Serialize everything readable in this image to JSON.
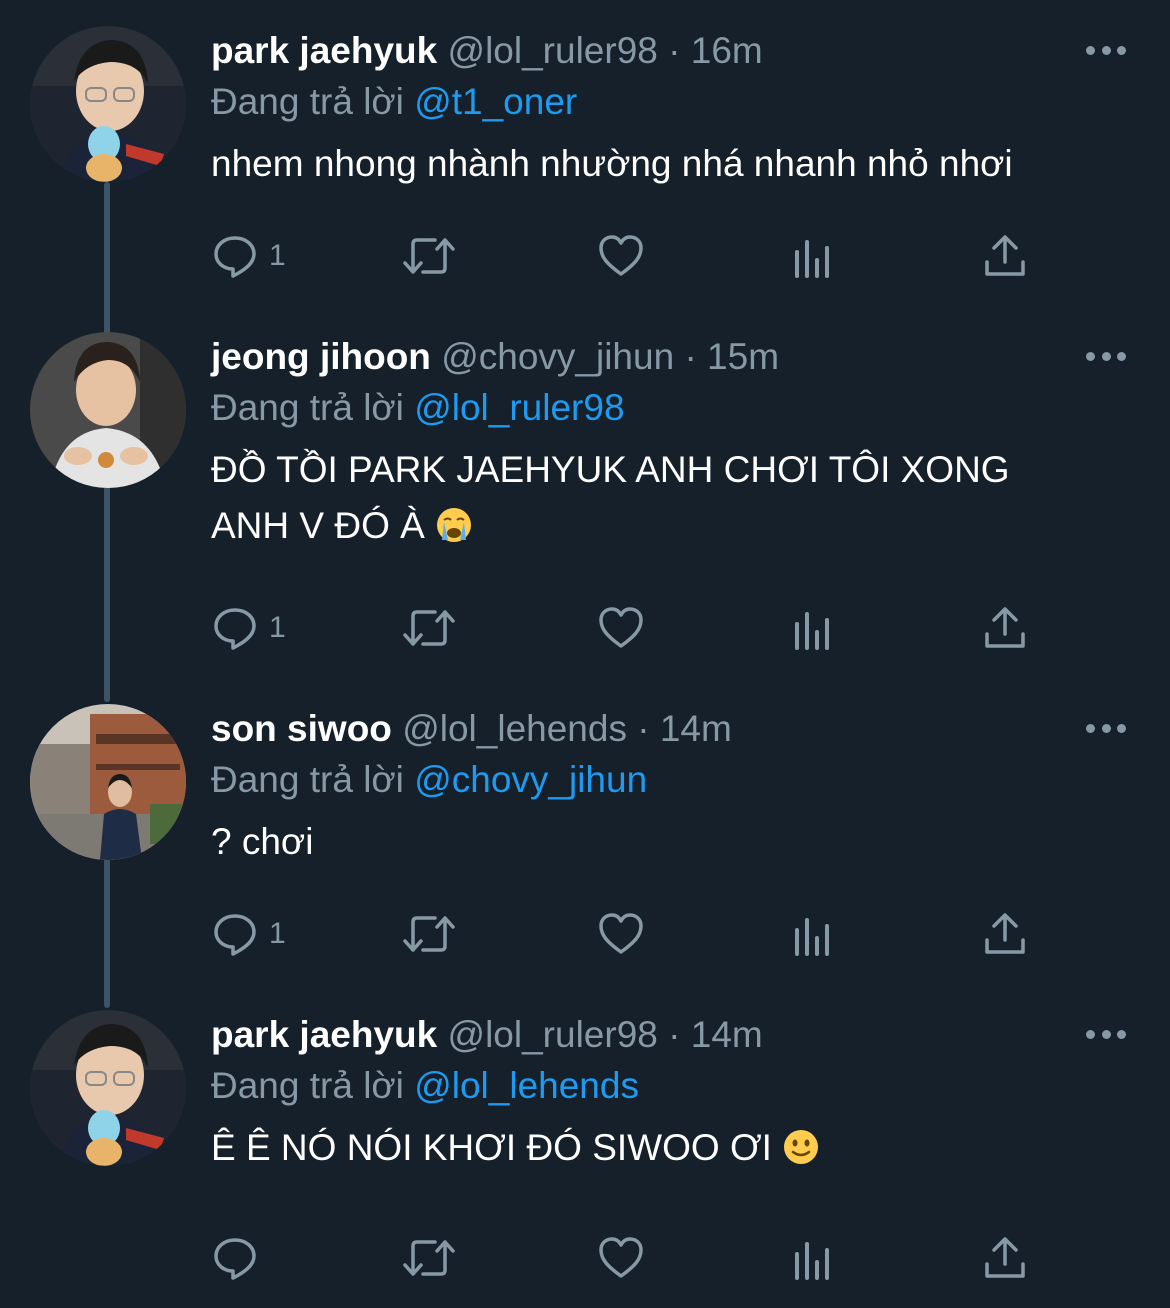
{
  "labels": {
    "reply_prefix": "Đang trả lời"
  },
  "colors": {
    "background": "#15202b",
    "text": "#ffffff",
    "muted": "#8899a6",
    "mention": "#1d9bf0",
    "thread_line": "#3d5466"
  },
  "tweets": [
    {
      "name": "park jaehyuk",
      "handle": "@lol_ruler98",
      "time": "16m",
      "reply_to": "@t1_oner",
      "text": "nhem nhong nhành nhường nhá nhanh nhỏ nhơi",
      "emoji": "",
      "reply_count": "1",
      "avatar": "person-with-plush-avatar"
    },
    {
      "name": "jeong jihoon",
      "handle": "@chovy_jihun",
      "time": "15m",
      "reply_to": "@lol_ruler98",
      "text": "ĐỒ TỒI PARK JAEHYUK ANH CHƠI TÔI XONG ANH V ĐÓ À",
      "emoji": "crying-face",
      "reply_count": "1",
      "avatar": "person-pointing-avatar"
    },
    {
      "name": "son siwoo",
      "handle": "@lol_lehends",
      "time": "14m",
      "reply_to": "@chovy_jihun",
      "text": "? chơi",
      "emoji": "",
      "reply_count": "1",
      "avatar": "person-street-avatar"
    },
    {
      "name": "park jaehyuk",
      "handle": "@lol_ruler98",
      "time": "14m",
      "reply_to": "@lol_lehends",
      "text": "Ê Ê NÓ NÓI KHƠI ĐÓ SIWOO ƠI",
      "emoji": "slightly-smiling-face",
      "reply_count": "",
      "avatar": "person-with-plush-avatar"
    }
  ]
}
